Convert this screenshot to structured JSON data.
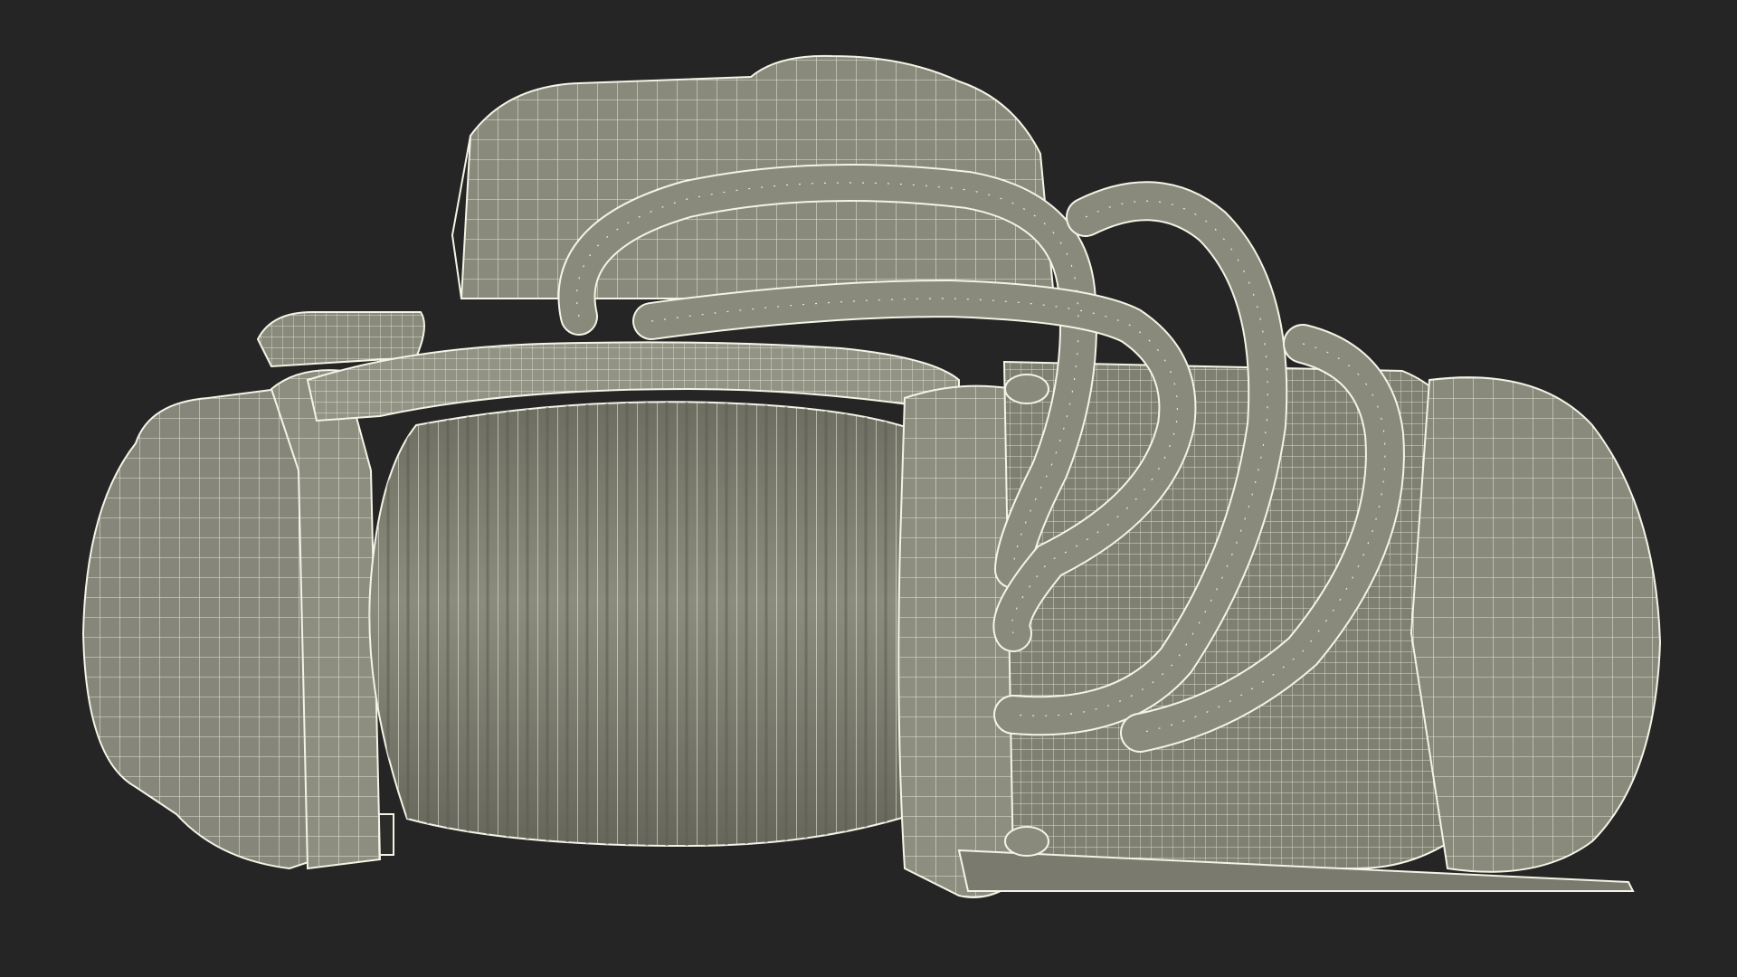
{
  "scene": {
    "subject": "winch-wireframe-render",
    "colors": {
      "background": "#252525",
      "surface": "#8a8a7c",
      "surface_light": "#9a9a8c",
      "surface_dark": "#6e6e62",
      "wire": "#f4f4e6",
      "shadow": "#4a4a42"
    }
  }
}
